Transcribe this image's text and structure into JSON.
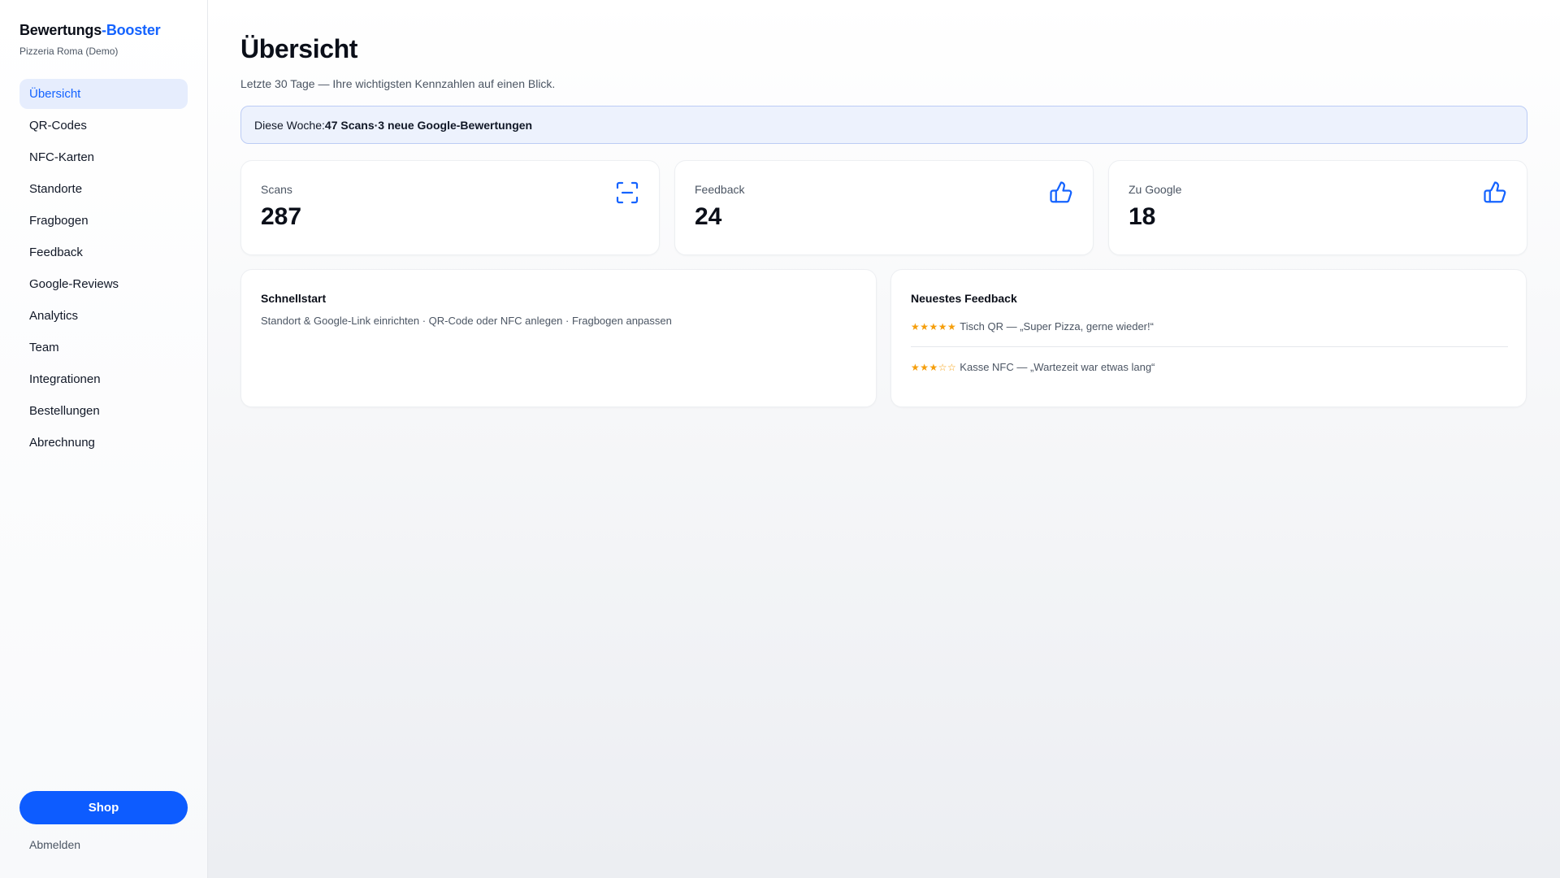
{
  "brand": {
    "name_main": "Bewertungs",
    "name_accent": "-Booster",
    "subtitle": "Pizzeria Roma (Demo)",
    "accent_color": "#1463ff"
  },
  "nav": {
    "items": [
      {
        "label": "Übersicht",
        "active": true
      },
      {
        "label": "QR-Codes"
      },
      {
        "label": "NFC-Karten"
      },
      {
        "label": "Standorte"
      },
      {
        "label": "Fragbogen"
      },
      {
        "label": "Feedback"
      },
      {
        "label": "Google-Reviews"
      },
      {
        "label": "Analytics"
      },
      {
        "label": "Team"
      },
      {
        "label": "Integrationen"
      },
      {
        "label": "Bestellungen"
      },
      {
        "label": "Abrechnung"
      }
    ],
    "shop_label": "Shop",
    "logout_label": "Abmelden"
  },
  "header": {
    "title": "Übersicht",
    "subtitle": "Letzte 30 Tage — Ihre wichtigsten Kennzahlen auf einen Blick."
  },
  "banner": {
    "prefix": "Diese Woche: ",
    "scans": "47 Scans",
    "separator": " · ",
    "reviews": "3 neue Google-Bewertungen"
  },
  "stats": [
    {
      "label": "Scans",
      "value": "287",
      "icon": "scan-icon"
    },
    {
      "label": "Feedback",
      "value": "24",
      "icon": "thumbs-up-icon"
    },
    {
      "label": "Zu Google",
      "value": "18",
      "icon": "thumbs-up-icon"
    }
  ],
  "quickstart": {
    "title": "Schnellstart",
    "text": "Standort & Google-Link einrichten · QR-Code oder NFC anlegen · Fragbogen anpassen"
  },
  "latest_feedback": {
    "title": "Neuestes Feedback",
    "items": [
      {
        "stars": "★★★★★",
        "rating": 5,
        "text": "Tisch QR — „Super Pizza, gerne wieder!“"
      },
      {
        "stars": "★★★☆☆",
        "rating": 3,
        "text": "Kasse NFC — „Wartezeit war etwas lang“"
      }
    ]
  },
  "colors": {
    "primary": "#0d5cff",
    "star": "#f59e0b",
    "active_nav_bg": "#e6edfd",
    "banner_bg": "#edf2fd",
    "banner_border": "#bcccf5"
  }
}
